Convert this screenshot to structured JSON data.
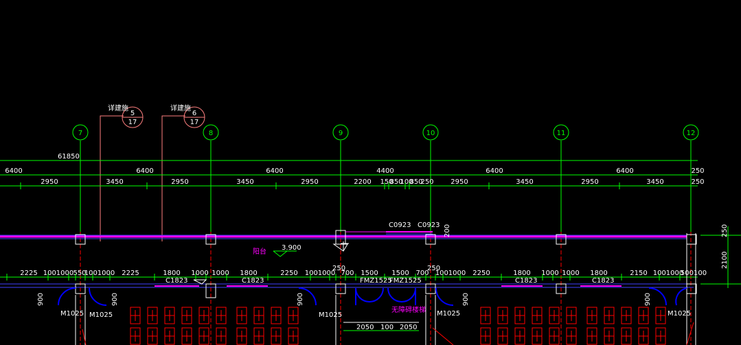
{
  "axes": [
    "7",
    "8",
    "9",
    "10",
    "11",
    "12"
  ],
  "overall_dim": "61850",
  "row1": [
    "6400",
    "6400",
    "6400",
    "4400",
    "6400",
    "6400",
    "250"
  ],
  "row2": [
    "2950",
    "3450",
    "2950",
    "3450",
    "2950",
    "2200",
    "150",
    "100",
    "250",
    "850",
    "850",
    "2950",
    "3450",
    "2950",
    "3450",
    "250"
  ],
  "detail_refs": [
    {
      "label": "详建施",
      "num": "5",
      "sheet": "17"
    },
    {
      "label": "详建施",
      "num": "6",
      "sheet": "17"
    }
  ],
  "windows_top": [
    "C0923",
    "C0923"
  ],
  "balcony_label": "阳台",
  "elevation": "3.900",
  "dim_250_top": "250",
  "dim_250_mid": "250",
  "dim_250_mid2": "250",
  "dim_200": "200",
  "row3": [
    "2225",
    "1001000",
    "550",
    "1001000",
    "2225",
    "1800",
    "1000",
    "1000",
    "1800",
    "2250",
    "1001000",
    "700",
    "1500",
    "1500",
    "700",
    "1001000",
    "2250",
    "1800",
    "1000",
    "1000",
    "1800",
    "2150",
    "1001000",
    "500100"
  ],
  "windows_bottom": [
    "C1823",
    "C1823",
    "FMZ1525",
    "FMZ1525",
    "C1823",
    "C1823"
  ],
  "door_labels": [
    "M1025",
    "M1025",
    "M1025",
    "M1025",
    "M1025"
  ],
  "dim_900": [
    "900",
    "900",
    "900",
    "900",
    "900"
  ],
  "barrier_free_label": "无障碍楼梯",
  "row4": [
    "2050",
    "100",
    "2050"
  ],
  "right_dims": [
    "250",
    "2100"
  ],
  "colors": {
    "green": "#00ff00",
    "magenta": "#ff00ff",
    "red": "#ff0000",
    "blue": "#0000ff",
    "white": "#ffffff"
  }
}
